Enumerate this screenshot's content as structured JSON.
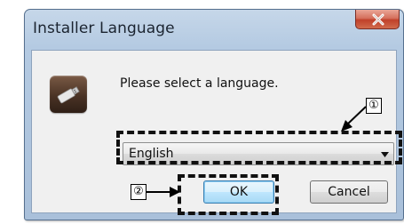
{
  "window": {
    "title": "Installer Language",
    "close_icon": "close-x-icon",
    "close_color": "#c9503a"
  },
  "dialog": {
    "app_icon": "usb-drive-icon",
    "prompt": "Please select a language.",
    "language_select": {
      "selected": "English",
      "dropdown_icon": "chevron-down-icon"
    },
    "buttons": {
      "ok_label": "OK",
      "cancel_label": "Cancel"
    }
  },
  "annotations": {
    "callout_1": "①",
    "callout_2": "②",
    "highlight_color": "#111111"
  }
}
